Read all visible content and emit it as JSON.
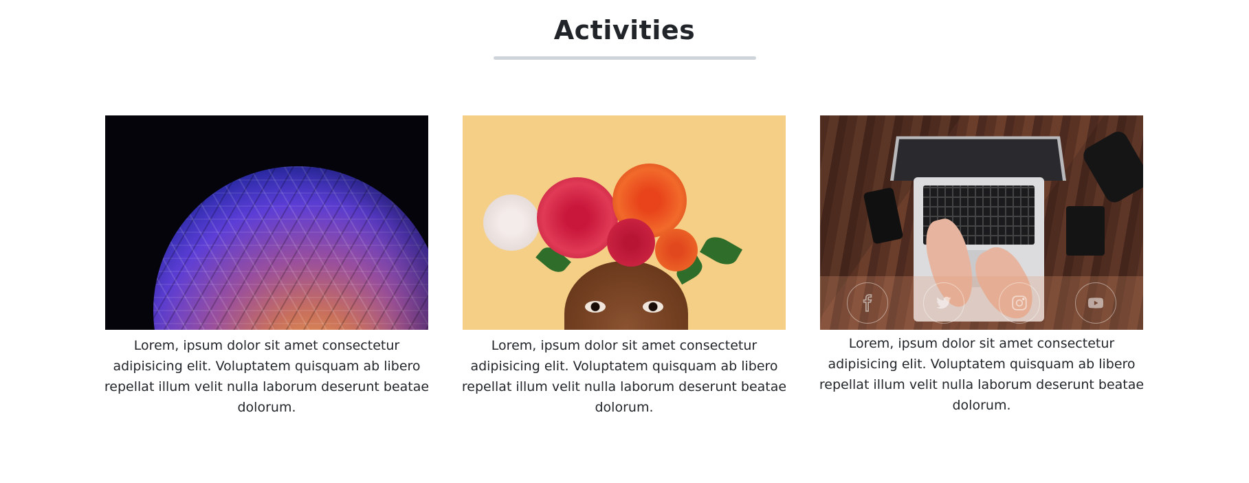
{
  "section": {
    "title": "Activities"
  },
  "cards": [
    {
      "image_subject": "illuminated geodesic sphere",
      "text": "Lorem, ipsum dolor sit amet consectetur adipisicing elit. Voluptatem quisquam ab libero repellat illum velit nulla laborum deserunt beatae dolorum."
    },
    {
      "image_subject": "person wearing flower crown",
      "text": "Lorem, ipsum dolor sit amet consectetur adipisicing elit. Voluptatem quisquam ab libero repellat illum velit nulla laborum deserunt beatae dolorum."
    },
    {
      "image_subject": "hands typing on laptop",
      "text": "Lorem, ipsum dolor sit amet consectetur adipisicing elit. Voluptatem quisquam ab libero repellat illum velit nulla laborum deserunt beatae dolorum.",
      "social_icons": [
        "facebook-icon",
        "twitter-icon",
        "instagram-icon",
        "youtube-icon"
      ]
    }
  ],
  "colors": {
    "text": "#212529",
    "underline": "#cfd4da",
    "social_overlay": "rgba(224,150,110,0.25)"
  }
}
